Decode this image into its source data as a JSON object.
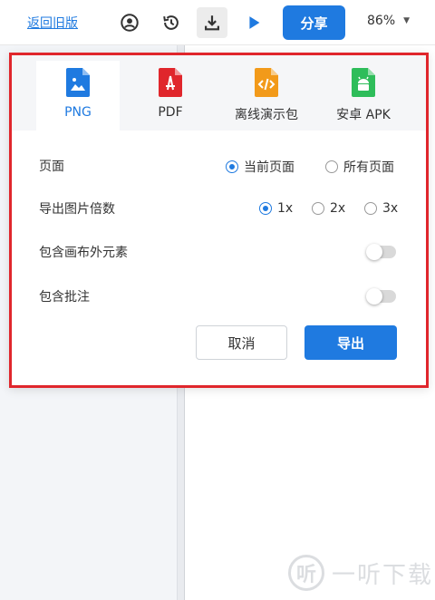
{
  "toolbar": {
    "back_link": "返回旧版",
    "share_label": "分享",
    "zoom_label": "86%",
    "icons": [
      "user-circle-icon",
      "history-icon",
      "download-icon",
      "play-icon"
    ]
  },
  "export_dialog": {
    "tabs": [
      {
        "label": "PNG",
        "icon": "image-file-icon",
        "color": "#1f7ae0",
        "active": true
      },
      {
        "label": "PDF",
        "icon": "pdf-file-icon",
        "color": "#e0262c",
        "active": false
      },
      {
        "label": "离线演示包",
        "icon": "code-file-icon",
        "color": "#f29a1a",
        "active": false
      },
      {
        "label": "安卓 APK",
        "icon": "android-file-icon",
        "color": "#2ebd5a",
        "active": false
      }
    ],
    "page_row": {
      "label": "页面",
      "options": [
        {
          "label": "当前页面",
          "checked": true
        },
        {
          "label": "所有页面",
          "checked": false
        }
      ]
    },
    "scale_row": {
      "label": "导出图片倍数",
      "options": [
        {
          "label": "1x",
          "checked": true
        },
        {
          "label": "2x",
          "checked": false
        },
        {
          "label": "3x",
          "checked": false
        }
      ]
    },
    "outside_row": {
      "label": "包含画布外元素",
      "enabled": false
    },
    "comments_row": {
      "label": "包含批注",
      "enabled": false
    },
    "cancel_label": "取消",
    "export_label": "导出"
  },
  "watermark": {
    "logo_text": "听",
    "text": "一听下载"
  },
  "colors": {
    "accent": "#1f7ae0",
    "highlight_border": "#e0262c"
  }
}
